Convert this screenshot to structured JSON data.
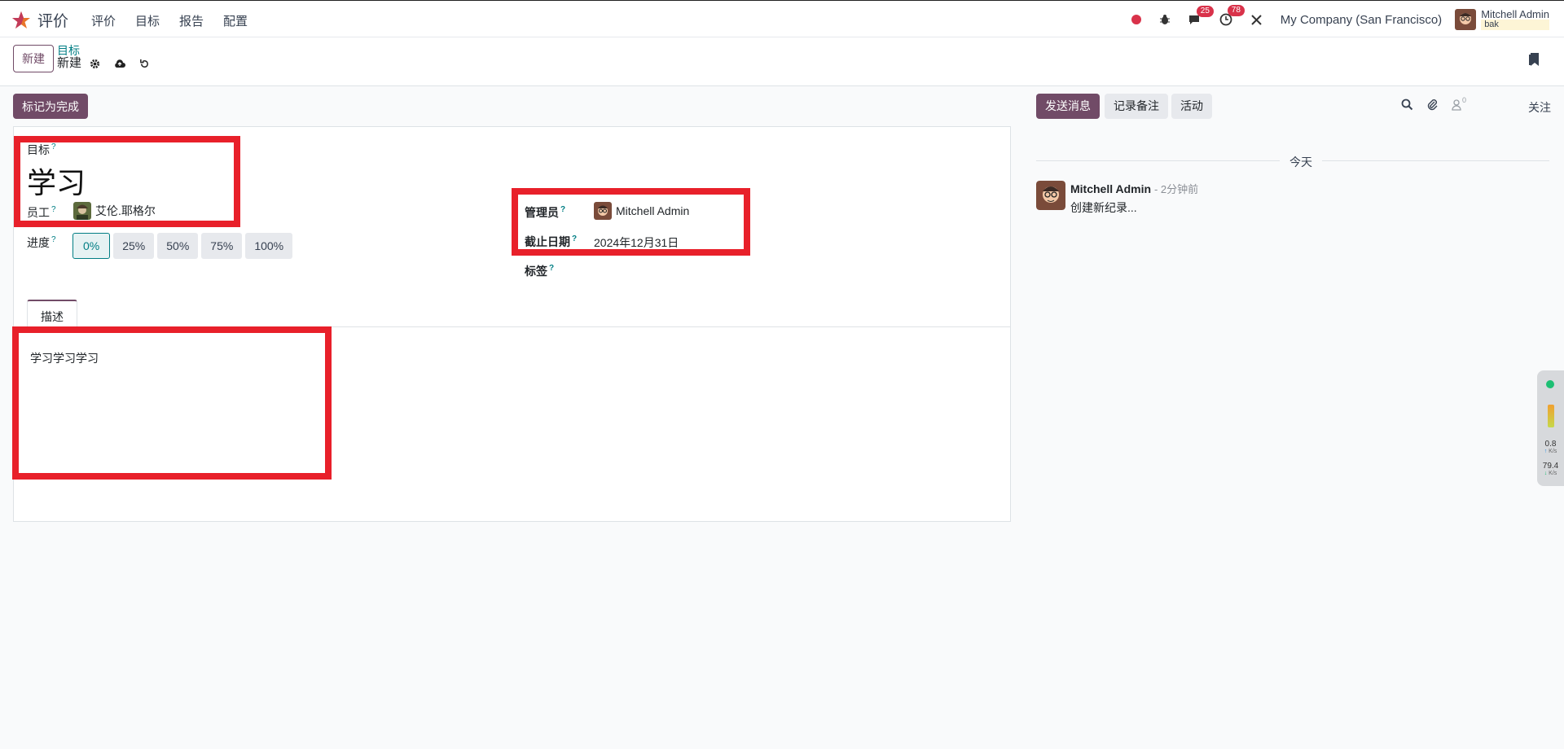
{
  "nav": {
    "app_name": "评价",
    "menu": [
      "评价",
      "目标",
      "报告",
      "配置"
    ],
    "chat_badge": "25",
    "activity_badge": "78",
    "company": "My Company (San Francisco)",
    "user_name": "Mitchell Admin",
    "db_name": "bak"
  },
  "control": {
    "new_label": "新建",
    "breadcrumb_parent": "目标",
    "breadcrumb_current": "新建"
  },
  "actions": {
    "mark_done": "标记为完成"
  },
  "form": {
    "goal_label": "目标",
    "goal_value": "学习",
    "employee_label": "员工",
    "employee_value": "艾伦.耶格尔",
    "progress_label": "进度",
    "progress_options": [
      "0%",
      "25%",
      "50%",
      "75%",
      "100%"
    ],
    "progress_selected": "0%",
    "manager_label": "管理员",
    "manager_value": "Mitchell Admin",
    "deadline_label": "截止日期",
    "deadline_value": "2024年12月31日",
    "tags_label": "标签",
    "help_mark": "?",
    "tab_description": "描述",
    "description": "学习学习学习"
  },
  "chatter": {
    "send_message": "发送消息",
    "log_note": "记录备注",
    "activity": "活动",
    "followers_count": "0",
    "follow": "关注",
    "today": "今天",
    "message": {
      "author": "Mitchell Admin",
      "time": "- 2分钟前",
      "body": "创建新纪录..."
    }
  },
  "widget": {
    "up_value": "0.8",
    "down_value": "79.4",
    "unit": "K/s"
  },
  "colors": {
    "brand": "#714b67",
    "link": "#017e84",
    "annotation": "#e8202a"
  }
}
